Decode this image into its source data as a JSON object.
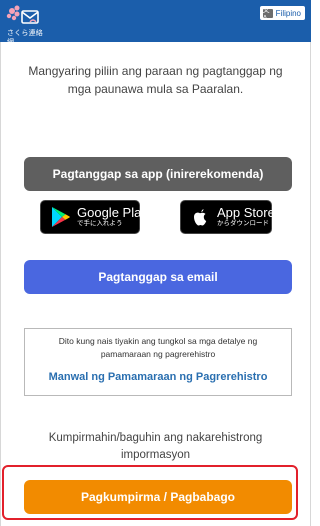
{
  "header": {
    "logo_text": "さくら連絡網",
    "language_label": "Filipino",
    "language_icon_glyph": "文A"
  },
  "intro_text": "Mangyaring piliin ang paraan ng pagtanggap ng mga paunawa mula sa Paaralan.",
  "buttons": {
    "app": "Pagtanggap sa app (inirerekomenda)",
    "email": "Pagtanggap sa email",
    "confirm": "Pagkumpirma / Pagbabago"
  },
  "stores": {
    "google": {
      "sub": "で手に入れよう",
      "main": "Google Play"
    },
    "apple": {
      "main": "App Store",
      "sub": "からダウンロード"
    }
  },
  "manual": {
    "description": "Dito kung nais tiyakin ang tungkol sa mga detalye ng pamamaraan ng pagrerehistro",
    "link": "Manwal ng Pamamaraan ng Pagrerehistro"
  },
  "confirm_text": "Kumpirmahin/baguhin ang nakarehistrong impormasyon",
  "colors": {
    "header": "#1b5eab",
    "app_button": "#5f5f5f",
    "email_button": "#4a67e0",
    "confirm_button": "#f28b00",
    "highlight": "#e2202b",
    "link": "#2a6fb0"
  }
}
